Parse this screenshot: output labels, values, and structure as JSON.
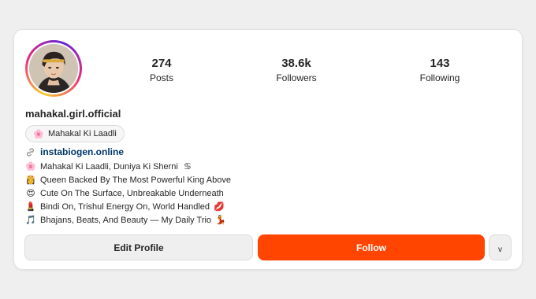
{
  "profile": {
    "username": "mahakal.girl.official",
    "category": {
      "icon": "🌸",
      "label": "Mahakal Ki Laadli"
    },
    "link": {
      "icon": "link-icon",
      "text": "instabiogen.online"
    },
    "bio": [
      {
        "emoji": "🌸",
        "text": "Mahakal Ki Laadli, Duniya Ki Sherni",
        "trail": "♋"
      },
      {
        "emoji": "👸",
        "text": "Queen Backed By The Most Powerful King Above",
        "trail": ""
      },
      {
        "emoji": "😍",
        "text": "Cute On The Surface, Unbreakable Underneath",
        "trail": ""
      },
      {
        "emoji": "💄",
        "text": "Bindi On, Trishul Energy On, World Handled",
        "trail": "💋"
      },
      {
        "emoji": "🎵",
        "text": "Bhajans, Beats, And Beauty — My Daily Trio",
        "trail": "💃"
      }
    ]
  },
  "stats": {
    "posts": {
      "value": "274",
      "label": "Posts"
    },
    "followers": {
      "value": "38.6k",
      "label": "Followers"
    },
    "following": {
      "value": "143",
      "label": "Following"
    }
  },
  "actions": {
    "edit_label": "Edit Profile",
    "follow_label": "Follow",
    "more_label": "v"
  },
  "colors": {
    "follow_bg": "#ff4500",
    "link": "#00376b",
    "card_bg": "#ffffff",
    "page_bg": "#efefef"
  }
}
